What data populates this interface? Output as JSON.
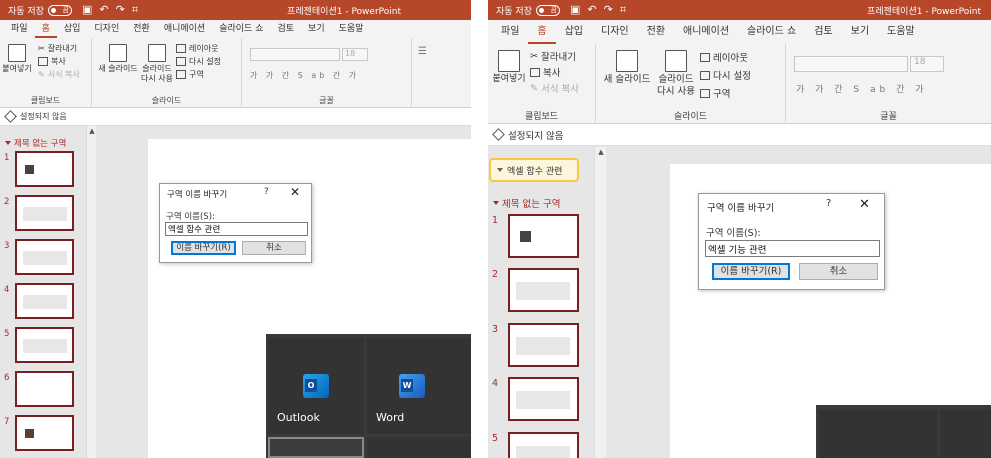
{
  "left": {
    "title": {
      "autosave": "자동 저장",
      "toggle": "끔",
      "doc": "프레젠테이션1  -  PowerPoint"
    },
    "tabs": [
      "파일",
      "홈",
      "삽입",
      "디자인",
      "전환",
      "애니메이션",
      "슬라이드 쇼",
      "검토",
      "보기",
      "도움말"
    ],
    "clipboard": {
      "paste": "붙여넣기",
      "cut": "잘라내기",
      "copy": "복사",
      "format": "서식 복사",
      "label": "클립보드"
    },
    "slides_group": {
      "new_slide": "새 슬라이드",
      "reuse": "슬라이드 다시 사용",
      "layout": "레이아웃",
      "reset": "다시 설정",
      "section": "구역",
      "label": "슬라이드"
    },
    "font_group": {
      "size": "18",
      "label": "글꼴"
    },
    "sensitivity": "설정되지 않음",
    "section_name": "제목 없는 구역",
    "slide_numbers": [
      "1",
      "2",
      "3",
      "4",
      "5",
      "6",
      "7"
    ],
    "dialog": {
      "title": "구역 이름 바꾸기",
      "help": "?",
      "close": "✕",
      "field_label": "구역 이름(S):",
      "value": "엑셀 함수 관련",
      "rename": "이름 바꾸기(R)",
      "cancel": "취소"
    },
    "tiles": {
      "outlook": "Outlook",
      "word": "Word"
    }
  },
  "right": {
    "title": {
      "autosave": "자동 저장",
      "toggle": "끔",
      "doc": "프레젠테이션1  -  PowerPoint"
    },
    "tabs": [
      "파일",
      "홈",
      "삽입",
      "디자인",
      "전환",
      "애니메이션",
      "슬라이드 쇼",
      "검토",
      "보기",
      "도움말"
    ],
    "clipboard": {
      "paste": "붙여넣기",
      "cut": "잘라내기",
      "copy": "복사",
      "format": "서식 복사",
      "label": "클립보드"
    },
    "slides_group": {
      "new_slide": "새 슬라이드",
      "reuse": "슬라이드 다시 사용",
      "layout": "레이아웃",
      "reset": "다시 설정",
      "section": "구역",
      "label": "슬라이드"
    },
    "font_group": {
      "size": "18",
      "label": "글꼴"
    },
    "sensitivity": "설정되지 않음",
    "new_section": "엑셀 함수 관련",
    "section_name": "제목 없는 구역",
    "slide_numbers": [
      "1",
      "2",
      "3",
      "4",
      "5"
    ],
    "dialog": {
      "title": "구역 이름 바꾸기",
      "help": "?",
      "close": "✕",
      "field_label": "구역 이름(S):",
      "value": "엑셀 기능 관련",
      "rename": "이름 바꾸기(R)",
      "cancel": "취소"
    }
  },
  "colors": {
    "accent": "#b7472a",
    "section": "#a52a2a",
    "highlight": "#f5c842"
  }
}
